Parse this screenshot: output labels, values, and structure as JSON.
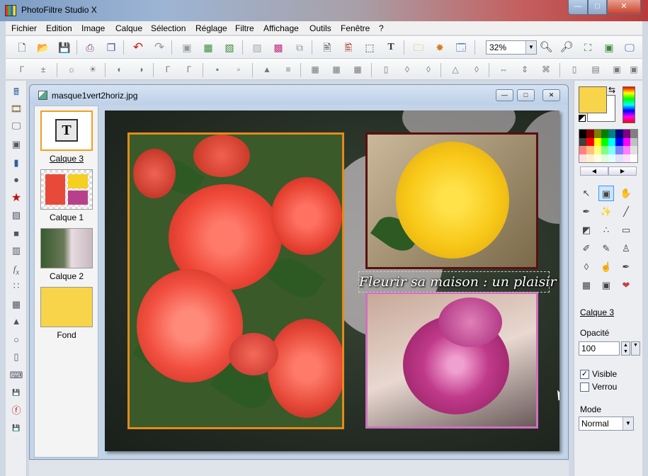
{
  "app": {
    "title": "PhotoFiltre Studio X"
  },
  "window_controls": {
    "minimize": "—",
    "maximize": "□",
    "close": "✕"
  },
  "menu": [
    "Fichier",
    "Edition",
    "Image",
    "Calque",
    "Sélection",
    "Réglage",
    "Filtre",
    "Affichage",
    "Outils",
    "Fenêtre",
    "?"
  ],
  "toolbar": {
    "zoom_value": "32%"
  },
  "document": {
    "title": "masque1vert2horiz.jpg"
  },
  "layers": [
    {
      "name": "Calque 3",
      "selected": true
    },
    {
      "name": "Calque 1",
      "selected": false
    },
    {
      "name": "Calque 2",
      "selected": false
    },
    {
      "name": "Fond",
      "selected": false
    }
  ],
  "canvas": {
    "caption": "Fleurir sa maison : un plaisir"
  },
  "colors": {
    "foreground": "#f8d44a",
    "background": "#ffffff",
    "frame_orange": "#e48a1c",
    "frame_maroon": "#5a1010",
    "frame_pink": "#d070c0"
  },
  "properties": {
    "layer_name": "Calque 3",
    "opacity_label": "Opacité",
    "opacity_value": "100",
    "visible_label": "Visible",
    "visible_checked": true,
    "lock_label": "Verrou",
    "lock_checked": false,
    "mode_label": "Mode",
    "mode_value": "Normal"
  },
  "icons": {
    "toolbar1": [
      "new-icon",
      "open-icon",
      "save-icon",
      "print-icon",
      "scan-icon",
      "undo-icon",
      "redo-icon",
      "paste-new-icon",
      "import-icon",
      "export-icon",
      "gradient-icon",
      "color-balance-icon",
      "rotate-icon",
      "layer-text-icon",
      "mask-icon",
      "selection-icon",
      "text-icon",
      "explorer-icon",
      "plugin-icon",
      "batch-icon",
      "zoom-in-icon",
      "zoom-out-icon",
      "fit-icon",
      "fullscreen-icon",
      "display-icon"
    ],
    "right_tools": [
      "pointer-icon",
      "selection-tool-icon",
      "hand-icon",
      "eyedropper-icon",
      "magic-wand-icon",
      "line-icon",
      "fill-icon",
      "spray-icon",
      "eraser-icon",
      "brush-icon",
      "advanced-brush-icon",
      "stamp-icon",
      "blur-icon",
      "smudge-icon",
      "clone-icon",
      "pattern-icon",
      "image-icon",
      "heal-icon"
    ]
  }
}
